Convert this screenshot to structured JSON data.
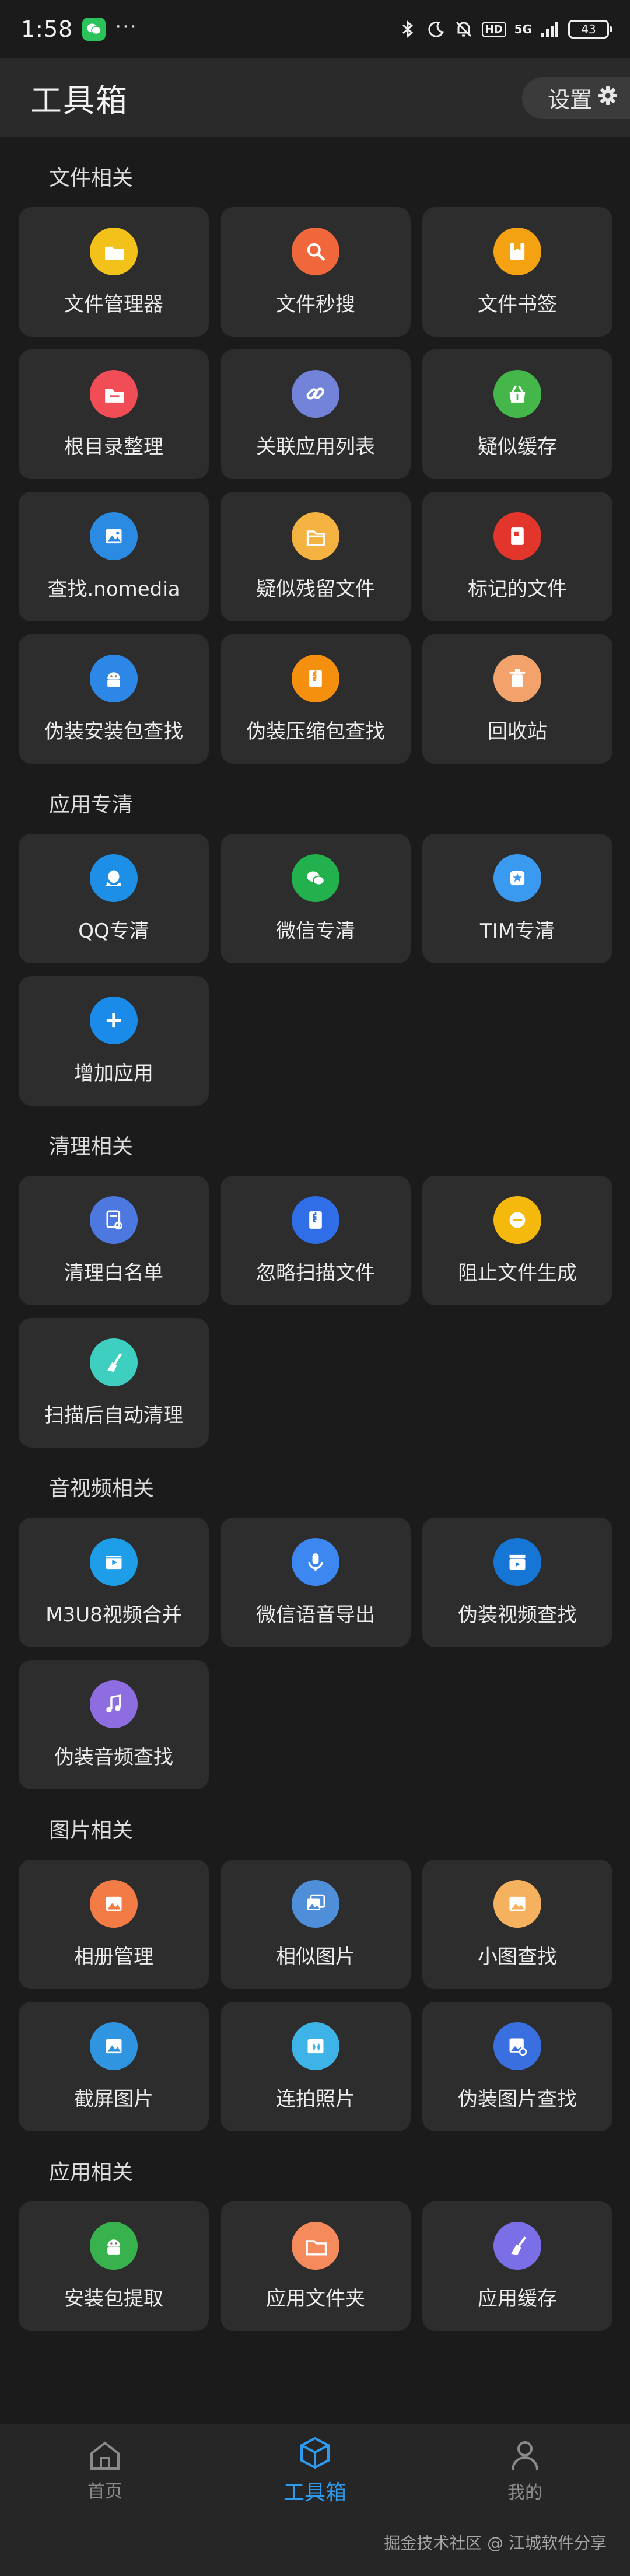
{
  "status_bar": {
    "time": "1:58",
    "dots": "···",
    "hd": "HD",
    "network": "5G",
    "battery": "43"
  },
  "header": {
    "title": "工具箱",
    "settings_label": "设置"
  },
  "colors": {
    "background": "#1b1b1b",
    "tile": "#2d2d2d",
    "accent": "#2d9cf0"
  },
  "sections": [
    {
      "title": "文件相关",
      "items": [
        {
          "label": "文件管理器",
          "icon": "folder-icon",
          "color": "#f2c21b"
        },
        {
          "label": "文件秒搜",
          "icon": "search-icon",
          "color": "#f1673c"
        },
        {
          "label": "文件书签",
          "icon": "bookmark-icon",
          "color": "#f5a212"
        },
        {
          "label": "根目录整理",
          "icon": "folder-sort-icon",
          "color": "#f04d57"
        },
        {
          "label": "关联应用列表",
          "icon": "link-icon",
          "color": "#7283d9"
        },
        {
          "label": "疑似缓存",
          "icon": "basket-icon",
          "color": "#45b64a"
        },
        {
          "label": "查找.nomedia",
          "icon": "image-icon",
          "color": "#2b8ae2"
        },
        {
          "label": "疑似残留文件",
          "icon": "folder-outline-icon",
          "color": "#f4b240"
        },
        {
          "label": "标记的文件",
          "icon": "flag-file-icon",
          "color": "#e2352c"
        },
        {
          "label": "伪装安装包查找",
          "icon": "android-icon",
          "color": "#2c87e6"
        },
        {
          "label": "伪装压缩包查找",
          "icon": "zip-icon",
          "color": "#f5900f"
        },
        {
          "label": "回收站",
          "icon": "trash-icon",
          "color": "#f2a26a"
        }
      ]
    },
    {
      "title": "应用专清",
      "items": [
        {
          "label": "QQ专清",
          "icon": "qq-icon",
          "color": "#1e8fe6"
        },
        {
          "label": "微信专清",
          "icon": "wechat-icon",
          "color": "#22b14c"
        },
        {
          "label": "TIM专清",
          "icon": "tim-icon",
          "color": "#3a9af0"
        },
        {
          "label": "增加应用",
          "icon": "plus-icon",
          "color": "#1a8be8"
        }
      ]
    },
    {
      "title": "清理相关",
      "items": [
        {
          "label": "清理白名单",
          "icon": "whitelist-icon",
          "color": "#4d78e0"
        },
        {
          "label": "忽略扫描文件",
          "icon": "zip-file-icon",
          "color": "#2f6ee6"
        },
        {
          "label": "阻止文件生成",
          "icon": "block-icon",
          "color": "#f5b80c"
        },
        {
          "label": "扫描后自动清理",
          "icon": "broom-icon",
          "color": "#3ecfc0"
        }
      ]
    },
    {
      "title": "音视频相关",
      "items": [
        {
          "label": "M3U8视频合并",
          "icon": "video-merge-icon",
          "color": "#1e9ee8"
        },
        {
          "label": "微信语音导出",
          "icon": "microphone-icon",
          "color": "#3d87f0"
        },
        {
          "label": "伪装视频查找",
          "icon": "clapper-icon",
          "color": "#1576d6"
        },
        {
          "label": "伪装音频查找",
          "icon": "music-icon",
          "color": "#8d6de0"
        }
      ]
    },
    {
      "title": "图片相关",
      "items": [
        {
          "label": "相册管理",
          "icon": "album-icon",
          "color": "#f37b45"
        },
        {
          "label": "相似图片",
          "icon": "similar-image-icon",
          "color": "#4f8ed8"
        },
        {
          "label": "小图查找",
          "icon": "small-image-icon",
          "color": "#f6b15e"
        },
        {
          "label": "截屏图片",
          "icon": "screenshot-icon",
          "color": "#2f95e0"
        },
        {
          "label": "连拍照片",
          "icon": "burst-photo-icon",
          "color": "#3eb3e8"
        },
        {
          "label": "伪装图片查找",
          "icon": "image-search-icon",
          "color": "#3a6fe0"
        }
      ]
    },
    {
      "title": "应用相关",
      "items": [
        {
          "label": "安装包提取",
          "icon": "android-icon",
          "color": "#37b24d"
        },
        {
          "label": "应用文件夹",
          "icon": "app-folder-icon",
          "color": "#f58b5c"
        },
        {
          "label": "应用缓存",
          "icon": "app-cache-icon",
          "color": "#7b6fe8"
        }
      ]
    }
  ],
  "bottom_nav": {
    "items": [
      {
        "label": "首页",
        "icon": "home-icon",
        "active": false
      },
      {
        "label": "工具箱",
        "icon": "toolbox-icon",
        "active": true
      },
      {
        "label": "我的",
        "icon": "profile-icon",
        "active": false
      }
    ]
  },
  "watermark": "掘金技术社区 @ 江城软件分享"
}
